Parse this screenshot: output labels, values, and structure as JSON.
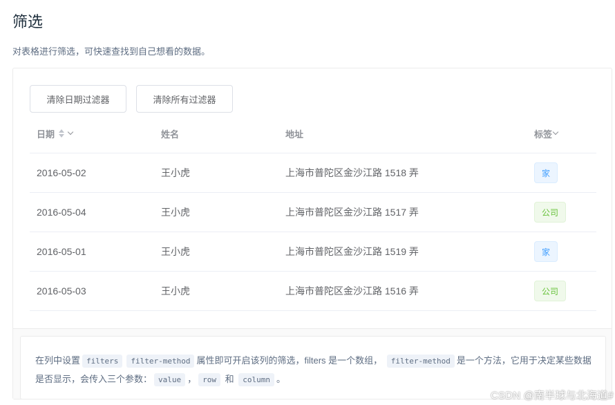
{
  "page": {
    "title": "筛选",
    "description": "对表格进行筛选，可快速查找到自己想看的数据。"
  },
  "buttons": {
    "clear_date": "清除日期过滤器",
    "clear_all": "清除所有过滤器"
  },
  "table": {
    "columns": [
      "日期",
      "姓名",
      "地址",
      "标签"
    ],
    "rows": [
      {
        "date": "2016-05-02",
        "name": "王小虎",
        "address": "上海市普陀区金沙江路 1518 弄",
        "tag": "家",
        "tag_type": "home"
      },
      {
        "date": "2016-05-04",
        "name": "王小虎",
        "address": "上海市普陀区金沙江路 1517 弄",
        "tag": "公司",
        "tag_type": "company"
      },
      {
        "date": "2016-05-01",
        "name": "王小虎",
        "address": "上海市普陀区金沙江路 1519 弄",
        "tag": "家",
        "tag_type": "home"
      },
      {
        "date": "2016-05-03",
        "name": "王小虎",
        "address": "上海市普陀区金沙江路 1516 弄",
        "tag": "公司",
        "tag_type": "company"
      }
    ]
  },
  "meta": {
    "t1": "在列中设置",
    "code_filters": "filters",
    "code_filter_method": "filter-method",
    "t2": "属性即可开启该列的筛选，filters 是一个数组，",
    "code_filter_method2": "filter-method",
    "t3": "是一个方法，它用于决定某些数据是否显示，会传入三个参数：",
    "code_value": "value",
    "comma": "，",
    "code_row": "row",
    "and": "和",
    "code_column": "column",
    "period": "。"
  },
  "watermark": "CSDN @南半球与北海道#",
  "colors": {
    "tag_home": "#409eff",
    "tag_company": "#67c23a",
    "header_text": "#909399",
    "cell_text": "#606266"
  }
}
